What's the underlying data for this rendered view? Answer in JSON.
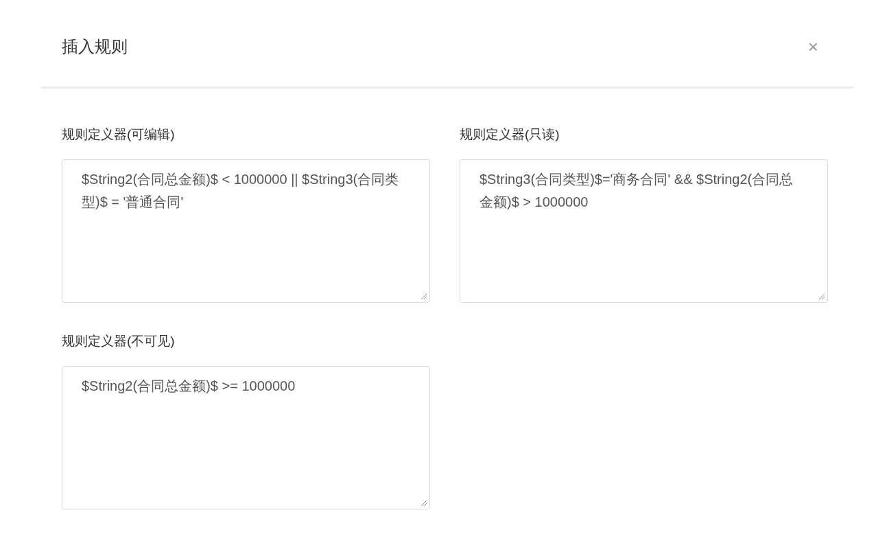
{
  "dialog": {
    "title": "插入规则",
    "close": "×"
  },
  "fields": [
    {
      "label": "规则定义器(可编辑)",
      "value": "$String2(合同总金额)$ < 1000000 || $String3(合同类型)$ = '普通合同'"
    },
    {
      "label": "规则定义器(只读)",
      "value": "$String3(合同类型)$='商务合同' && $String2(合同总金额)$ > 1000000"
    },
    {
      "label": "规则定义器(不可见)",
      "value": "$String2(合同总金额)$ >= 1000000"
    }
  ]
}
